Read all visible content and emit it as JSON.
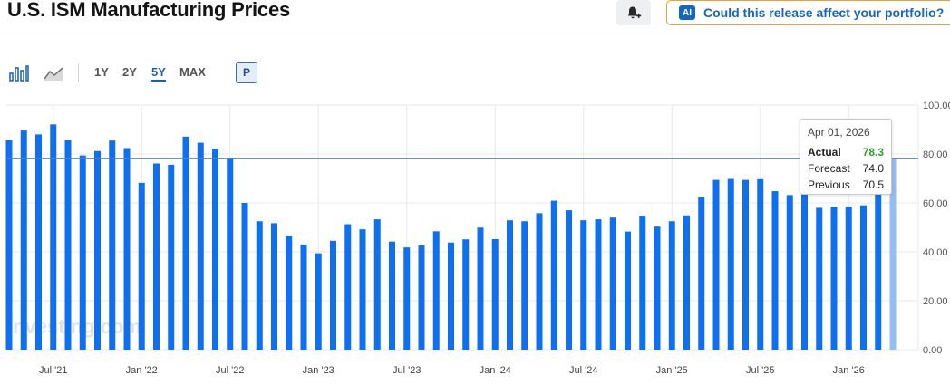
{
  "header": {
    "title": "U.S. ISM Manufacturing Prices",
    "ai_badge": "AI",
    "ai_prompt": "Could this release affect your portfolio?"
  },
  "toolbar": {
    "ranges": [
      "1Y",
      "2Y",
      "5Y",
      "MAX"
    ],
    "active_range": "5Y",
    "p_label": "P"
  },
  "watermark": "Investing.com",
  "tooltip": {
    "date": "Apr 01, 2026",
    "actual_label": "Actual",
    "actual_value": "78.3",
    "forecast_label": "Forecast",
    "forecast_value": "74.0",
    "previous_label": "Previous",
    "previous_value": "70.5"
  },
  "colors": {
    "bar": "#0e6ff0",
    "bar_highlight": "#94bdf5",
    "reference_line": "#4a86c8",
    "actual_green": "#2e9e2e"
  },
  "chart_data": {
    "type": "bar",
    "y_ticks": [
      "100.00",
      "80.00",
      "60.00",
      "40.00",
      "20.00",
      "0.00"
    ],
    "ylim": [
      0,
      100
    ],
    "x_ticks": [
      {
        "label": "Jul '21",
        "index": 3
      },
      {
        "label": "Jan '22",
        "index": 9
      },
      {
        "label": "Jul '22",
        "index": 15
      },
      {
        "label": "Jan '23",
        "index": 21
      },
      {
        "label": "Jul '23",
        "index": 27
      },
      {
        "label": "Jan '24",
        "index": 33
      },
      {
        "label": "Jul '24",
        "index": 39
      },
      {
        "label": "Jan '25",
        "index": 45
      },
      {
        "label": "Jul '25",
        "index": 51
      },
      {
        "label": "Jan '26",
        "index": 57
      }
    ],
    "start_month": "Apr 2021",
    "values": [
      85.6,
      89.6,
      88.0,
      92.1,
      85.7,
      79.4,
      81.2,
      85.5,
      82.4,
      68.2,
      76.1,
      75.6,
      87.1,
      84.6,
      82.2,
      78.5,
      60.0,
      52.5,
      51.7,
      46.6,
      43.0,
      39.4,
      44.5,
      51.3,
      49.2,
      53.3,
      44.2,
      41.8,
      42.6,
      48.4,
      43.8,
      45.1,
      49.9,
      45.2,
      52.9,
      52.5,
      55.8,
      60.9,
      57.0,
      52.9,
      53.3,
      54.0,
      48.3,
      54.8,
      50.3,
      52.5,
      54.9,
      62.4,
      69.4,
      69.8,
      69.4,
      69.7,
      64.8,
      63.2,
      65.4,
      58.0,
      58.5,
      58.5,
      59.0,
      70.5,
      78.3
    ],
    "highlight_index": 60,
    "reference_value": 78.3
  }
}
